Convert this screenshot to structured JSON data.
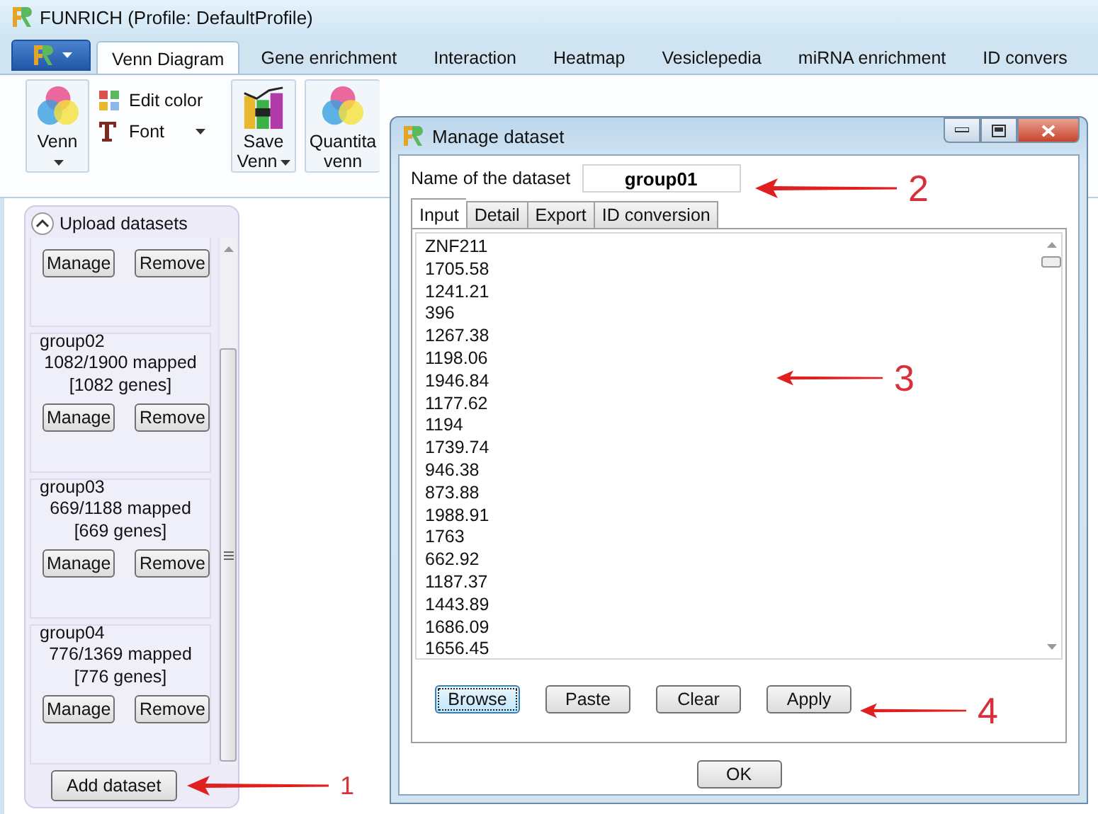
{
  "window": {
    "title": "FUNRICH (Profile:  DefaultProfile)"
  },
  "ribbon": {
    "tabs": [
      {
        "label": "Venn Diagram",
        "selected": true
      },
      {
        "label": "Gene enrichment",
        "selected": false
      },
      {
        "label": "Interaction",
        "selected": false
      },
      {
        "label": "Heatmap",
        "selected": false
      },
      {
        "label": "Vesiclepedia",
        "selected": false
      },
      {
        "label": "miRNA enrichment",
        "selected": false
      },
      {
        "label": "ID convers",
        "selected": false
      }
    ],
    "tools": [
      {
        "kind": "venn",
        "lines": [
          "Venn"
        ],
        "dropdown": true
      },
      {
        "kind": "stack",
        "items": [
          {
            "label": "Edit color",
            "dropdown": false
          },
          {
            "label": "Font",
            "dropdown": true
          }
        ]
      },
      {
        "kind": "chart",
        "lines": [
          "Save",
          "Venn"
        ],
        "dropdown": true
      },
      {
        "kind": "venn",
        "lines": [
          "Quantita",
          "venn"
        ],
        "dropdown": false
      }
    ]
  },
  "upload_panel": {
    "title": "Upload datasets",
    "expanded": true,
    "datasets": [
      {
        "buttons": [
          "Manage",
          "Remove"
        ]
      },
      {
        "name": "group02",
        "mapped": "1082/1900 mapped",
        "genes": "[1082 genes]",
        "buttons": [
          "Manage",
          "Remove"
        ]
      },
      {
        "name": "group03",
        "mapped": "669/1188 mapped",
        "genes": "[669 genes]",
        "buttons": [
          "Manage",
          "Remove"
        ]
      },
      {
        "name": "group04",
        "mapped": "776/1369 mapped",
        "genes": "[776 genes]",
        "buttons": [
          "Manage",
          "Remove"
        ]
      }
    ],
    "add_button": "Add dataset"
  },
  "dialog": {
    "title": "Manage dataset",
    "name_label": "Name of the dataset",
    "name_value": "group01",
    "tabs": [
      {
        "label": "Input",
        "selected": true
      },
      {
        "label": "Detail",
        "selected": false
      },
      {
        "label": "Export",
        "selected": false
      },
      {
        "label": "ID conversion",
        "selected": false
      }
    ],
    "input_lines": [
      "ZNF211",
      "1705.58",
      "1241.21",
      "396",
      "1267.38",
      "1198.06",
      "1946.84",
      "1177.62",
      "1194",
      "1739.74",
      "946.38",
      "873.88",
      "1988.91",
      "1763",
      "662.92",
      "1187.37",
      "1443.89",
      "1686.09",
      "1656.45"
    ],
    "buttons": [
      {
        "label": "Browse",
        "focused": true
      },
      {
        "label": "Paste",
        "focused": false
      },
      {
        "label": "Clear",
        "focused": false
      },
      {
        "label": "Apply",
        "focused": false
      }
    ],
    "ok_button": "OK"
  },
  "annotations": [
    {
      "label": "1"
    },
    {
      "label": "2"
    },
    {
      "label": "3"
    },
    {
      "label": "4"
    }
  ]
}
